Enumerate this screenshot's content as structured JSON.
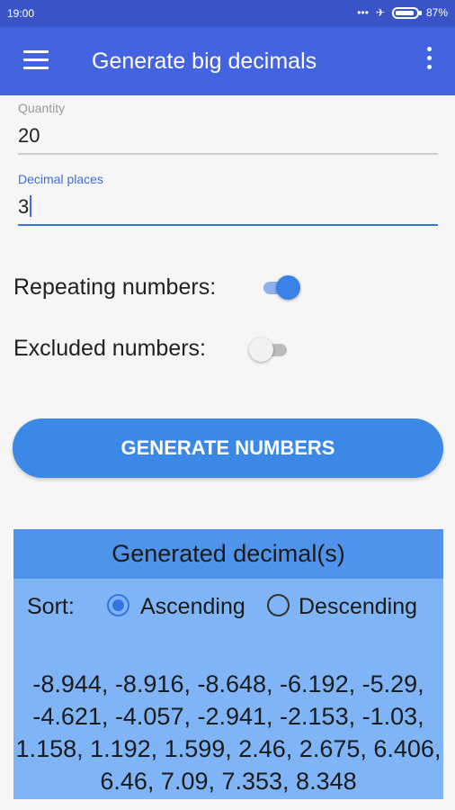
{
  "status_bar": {
    "time": "19:00",
    "icons": [
      "dots-icon",
      "airplane-icon",
      "battery-icon"
    ],
    "battery": "87%"
  },
  "app_bar": {
    "title": "Generate big decimals"
  },
  "form": {
    "quantity": {
      "label": "Quantity",
      "value": "20"
    },
    "decimal_places": {
      "label": "Decimal places",
      "value": "3"
    },
    "repeating": {
      "label": "Repeating numbers:",
      "on": true
    },
    "excluded": {
      "label": "Excluded numbers:",
      "on": false
    },
    "generate_label": "GENERATE NUMBERS"
  },
  "result": {
    "title": "Generated decimal(s)",
    "sort_label": "Sort:",
    "sort_options": [
      "Ascending",
      "Descending"
    ],
    "sort_selected": "Ascending",
    "numbers_text": "-8.944, -8.916, -8.648, -6.192, -5.29, -4.621, -4.057, -2.941, -2.153, -1.03, 1.158, 1.192, 1.599, 2.46, 2.675, 6.406, 6.46, 7.09, 7.353, 8.348"
  },
  "colors": {
    "appbar": "#4363e0",
    "statusbar": "#3a54c8",
    "accent": "#3b88e6",
    "result_bg": "#7fb4f7",
    "result_header": "#4f93ea"
  }
}
